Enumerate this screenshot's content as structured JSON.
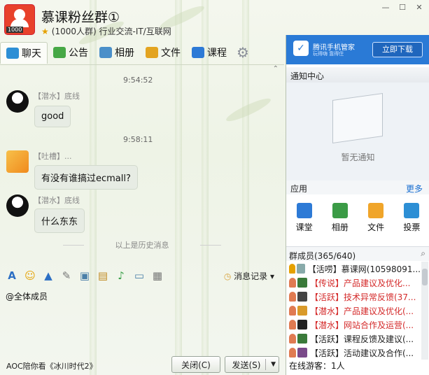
{
  "header": {
    "group_name": "慕课粉丝群①",
    "group_meta": "(1000人群) 行业交流-IT/互联网",
    "avatar_text": "1000"
  },
  "tabs": [
    {
      "label": "聊天",
      "icon": "chat-icon",
      "color": "#2d8fd5"
    },
    {
      "label": "公告",
      "icon": "announcement-icon",
      "color": "#46a845"
    },
    {
      "label": "相册",
      "icon": "album-icon",
      "color": "#4a8fc9"
    },
    {
      "label": "文件",
      "icon": "folder-icon",
      "color": "#e3a421"
    },
    {
      "label": "课程",
      "icon": "course-icon",
      "color": "#2d7ad6"
    }
  ],
  "messages": [
    {
      "time": "9:54:52",
      "sender": "【潜水】底线",
      "text": "good"
    },
    {
      "time": "9:58:11",
      "sender": "【吐槽】...",
      "text": "有没有谁搞过ecmall?"
    },
    {
      "time": "",
      "sender": "【潜水】底线",
      "text": "什么东东"
    }
  ],
  "history_label": "以上是历史消息",
  "toolbar": {
    "message_record": "消息记录"
  },
  "input": {
    "value": "@全体成员"
  },
  "bottom": {
    "ad_text": "AOC陪你看《冰川时代2》",
    "close_label": "关闭(C)",
    "send_label": "发送(S)"
  },
  "right": {
    "ad": {
      "title": "腾讯手机管家",
      "subtitle": "玩得嗨 靠得住",
      "download": "立即下载"
    },
    "notify_title": "通知中心",
    "notify_empty": "暂无通知",
    "apps_title": "应用",
    "more": "更多",
    "apps": [
      "课堂",
      "相册",
      "文件",
      "投票"
    ],
    "members_title": "群成员(365/640)",
    "members": [
      {
        "text": "【活唠】慕课网(10598091...",
        "red": false
      },
      {
        "text": "【传说】产品建议及优化...",
        "red": true
      },
      {
        "text": "【活跃】技术异常反馈(37...",
        "red": true
      },
      {
        "text": "【潜水】产品建议及优化(...",
        "red": true
      },
      {
        "text": "【潜水】网站合作及运营(...",
        "red": true
      },
      {
        "text": "【活跃】课程反馈及建议(...",
        "red": false
      },
      {
        "text": "【活跃】活动建议及合作(...",
        "red": false
      }
    ],
    "online": "在线游客：1人"
  }
}
